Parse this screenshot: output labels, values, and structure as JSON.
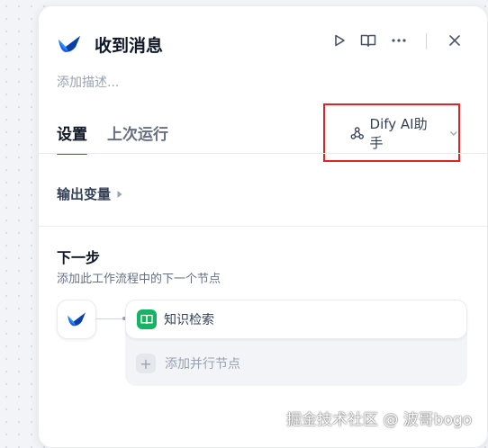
{
  "node": {
    "title": "收到消息",
    "description_placeholder": "添加描述..."
  },
  "header_icons": {
    "run": "play-icon",
    "docs": "book-open-icon",
    "more": "more-icon",
    "close": "close-icon"
  },
  "tabs": [
    {
      "label": "设置",
      "active": true
    },
    {
      "label": "上次运行",
      "active": false
    }
  ],
  "assistant_selector": {
    "label": "Dify AI助手",
    "icon": "webhook-icon",
    "highlight_color": "#e02424"
  },
  "output_vars": {
    "label": "输出变量"
  },
  "next_step": {
    "title": "下一步",
    "subtitle": "添加此工作流程中的下一个节点",
    "next_node_label": "知识检索",
    "add_parallel_label": "添加并行节点"
  },
  "watermark": "掘金技术社区 @ 波哥bogo",
  "colors": {
    "accent": "#155eef",
    "knowledge_icon_bg": "#16b364"
  }
}
